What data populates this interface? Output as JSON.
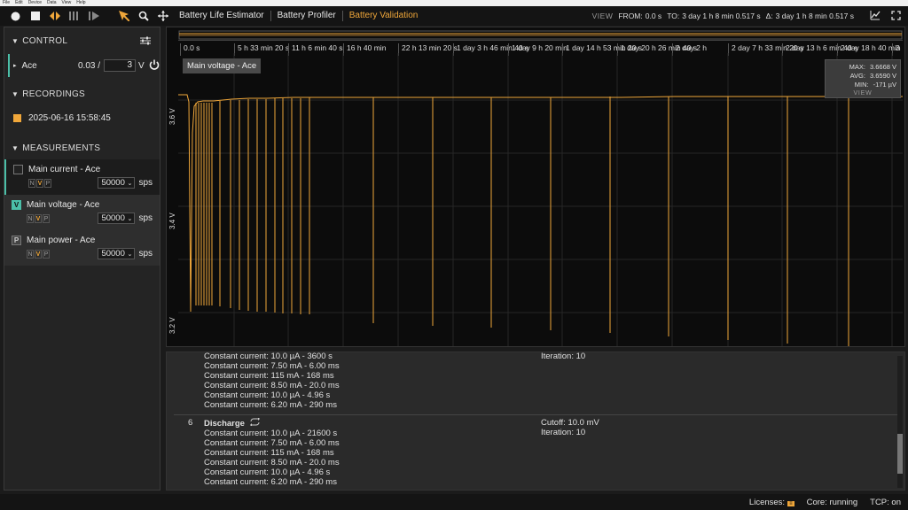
{
  "menu": [
    "File",
    "Edit",
    "Device",
    "Data",
    "View",
    "Help"
  ],
  "tabs": [
    {
      "label": "Battery Life Estimator",
      "active": false
    },
    {
      "label": "Battery Profiler",
      "active": false
    },
    {
      "label": "Battery Validation",
      "active": true
    }
  ],
  "view": {
    "label": "VIEW",
    "from_label": "FROM:",
    "from": "0.0 s",
    "to_label": "TO:",
    "to": "3 day 1 h 8 min 0.517 s",
    "delta_label": "Δ:",
    "delta": "3 day 1 h 8 min 0.517 s"
  },
  "sidebar": {
    "control": {
      "title": "CONTROL",
      "device": "Ace",
      "value": "0.03 /",
      "setpoint": "3",
      "unit": "V"
    },
    "recordings": {
      "title": "RECORDINGS",
      "items": [
        "2025-06-16 15:58:45"
      ]
    },
    "measurements": {
      "title": "MEASUREMENTS",
      "items": [
        {
          "label": "Main current - Ace",
          "badge": "",
          "rate": "50000",
          "unit": "sps"
        },
        {
          "label": "Main voltage - Ace",
          "badge": "V",
          "rate": "50000",
          "unit": "sps"
        },
        {
          "label": "Main power - Ace",
          "badge": "P",
          "rate": "50000",
          "unit": "sps"
        }
      ]
    }
  },
  "plot": {
    "chip": "Main voltage - Ace",
    "stats": {
      "max_label": "MAX:",
      "max": "3.6668 V",
      "avg_label": "AVG:",
      "avg": "3.6590 V",
      "min_label": "MIN:",
      "min": "-171 µV",
      "view": "VIEW"
    },
    "y_labels": [
      "3.6 V",
      "3.4 V",
      "3.2 V"
    ],
    "x_ticks": [
      "0.0 s",
      "5 h 33 min 20 s",
      "11 h 6 min 40 s",
      "16 h 40 min",
      "22 h 13 min 20 s",
      "1 day 3 h 46 min 40 s",
      "1 day 9 h 20 min",
      "1 day 14 h 53 min 20 s",
      "1 day 20 h 26 min 40 s",
      "2 day 2 h",
      "2 day 7 h 33 min 20 s",
      "2 day 13 h 6 min 40 s",
      "2 day 18 h 40 min",
      "3"
    ]
  },
  "steps": {
    "block1": {
      "lines": [
        "Constant current: 10.0 µA - 3600 s",
        "Constant current: 7.50 mA - 6.00 ms",
        "Constant current: 115 mA - 168 ms",
        "Constant current: 8.50 mA - 20.0 ms",
        "Constant current: 10.0 µA - 4.96 s",
        "Constant current: 6.20 mA - 290 ms"
      ],
      "right": [
        "Iteration: 10"
      ]
    },
    "block2": {
      "num": "6",
      "title": "Discharge",
      "lines": [
        "Constant current: 10.0 µA - 21600 s",
        "Constant current: 7.50 mA - 6.00 ms",
        "Constant current: 115 mA - 168 ms",
        "Constant current: 8.50 mA - 20.0 ms",
        "Constant current: 10.0 µA - 4.96 s",
        "Constant current: 6.20 mA - 290 ms"
      ],
      "right": [
        "Cutoff: 10.0 mV",
        "Iteration: 10"
      ]
    }
  },
  "status": {
    "licenses": "Licenses:",
    "lic_badge": "≡",
    "core": "Core: running",
    "tcp": "TCP: on"
  },
  "colors": {
    "accent": "#f0a73a",
    "teal": "#4bbfa8"
  }
}
